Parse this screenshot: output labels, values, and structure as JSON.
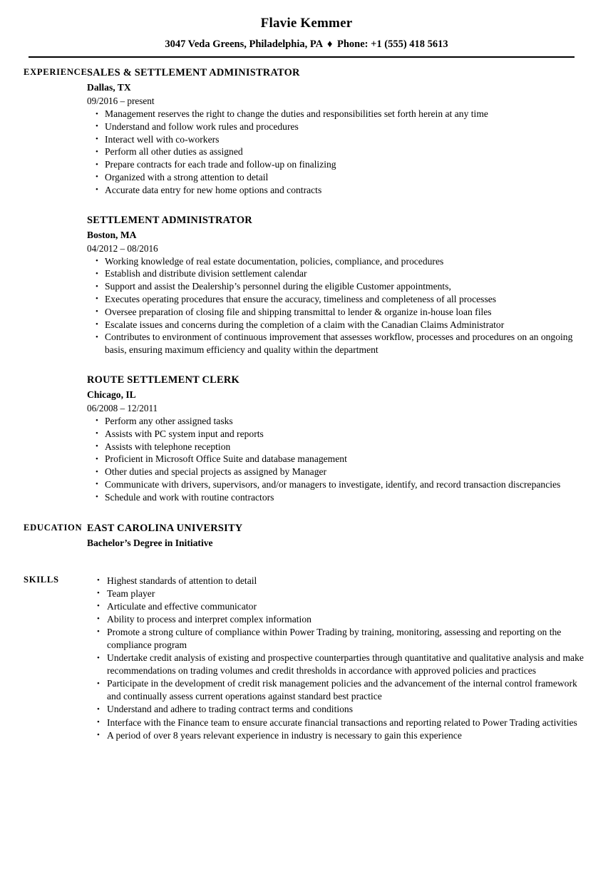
{
  "header": {
    "name": "Flavie Kemmer",
    "address": "3047 Veda Greens, Philadelphia, PA",
    "separator": "♦",
    "phone": "Phone: +1 (555) 418 5613"
  },
  "sections": {
    "experience_label": "EXPERIENCE",
    "education_label": "EDUCATION",
    "skills_label": "SKILLS"
  },
  "experience": [
    {
      "title": "SALES & SETTLEMENT ADMINISTRATOR",
      "location": "Dallas, TX",
      "dates": "09/2016 – present",
      "bullets": [
        "Management reserves the right to change the duties and responsibilities set forth herein at any time",
        "Understand and follow work rules and procedures",
        "Interact well with co-workers",
        "Perform all other duties as assigned",
        "Prepare contracts for each trade and follow-up on finalizing",
        "Organized with a strong attention to detail",
        "Accurate data entry for new home options and contracts"
      ]
    },
    {
      "title": "SETTLEMENT ADMINISTRATOR",
      "location": "Boston, MA",
      "dates": "04/2012 – 08/2016",
      "bullets": [
        "Working knowledge of real estate documentation, policies, compliance, and procedures",
        "Establish and distribute division settlement calendar",
        "Support and assist the Dealership’s personnel during the eligible Customer appointments,",
        "Executes operating procedures that ensure the accuracy, timeliness and completeness of all processes",
        "Oversee preparation of closing file and shipping transmittal to lender & organize in-house loan files",
        "Escalate issues and concerns during the completion of a claim with the Canadian Claims Administrator",
        "Contributes to environment of continuous improvement that assesses workflow, processes and procedures on an ongoing basis, ensuring maximum efficiency and quality within the department"
      ]
    },
    {
      "title": "ROUTE SETTLEMENT CLERK",
      "location": "Chicago, IL",
      "dates": "06/2008 – 12/2011",
      "bullets": [
        "Perform any other assigned tasks",
        "Assists with PC system input and reports",
        "Assists with telephone reception",
        "Proficient in Microsoft Office Suite and database management",
        "Other duties and special projects as assigned by Manager",
        "Communicate with drivers, supervisors, and/or managers to investigate, identify, and record transaction discrepancies",
        "Schedule and work with routine contractors"
      ]
    }
  ],
  "education": [
    {
      "school": "EAST CAROLINA UNIVERSITY",
      "degree": "Bachelor’s Degree in Initiative"
    }
  ],
  "skills": [
    "Highest standards of attention to detail",
    "Team player",
    "Articulate and effective communicator",
    "Ability to process and interpret complex information",
    "Promote a strong culture of compliance within Power Trading by training, monitoring, assessing and reporting on the compliance program",
    "Undertake credit analysis of existing and prospective counterparties through quantitative and qualitative analysis and make recommendations on trading volumes and credit thresholds in accordance with approved policies and practices",
    "Participate in the development of credit risk management policies and the advancement of the internal control framework and continually assess current operations against standard best practice",
    "Understand and adhere to trading contract terms and conditions",
    "Interface with the Finance team to ensure accurate financial transactions and reporting related to Power Trading activities",
    "A period of over 8 years relevant experience in industry is necessary to gain this experience"
  ]
}
